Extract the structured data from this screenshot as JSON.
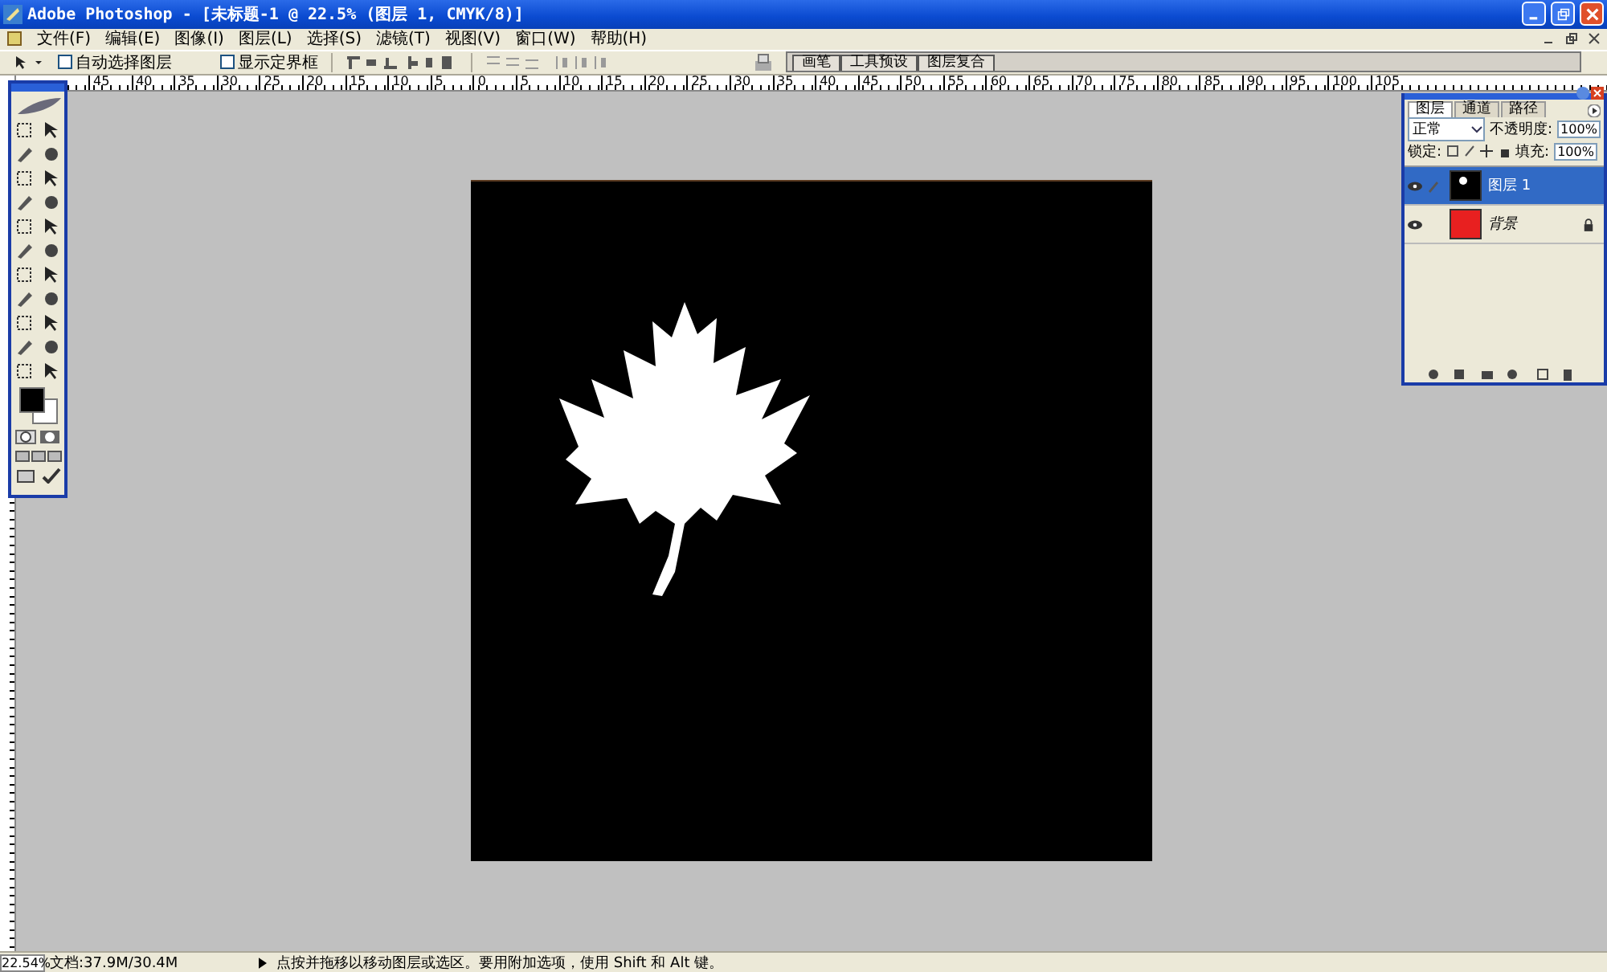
{
  "window": {
    "title": "Adobe Photoshop - [未标题-1 @ 22.5% (图层 1, CMYK/8)]"
  },
  "menu": [
    "文件(F)",
    "编辑(E)",
    "图像(I)",
    "图层(L)",
    "选择(S)",
    "滤镜(T)",
    "视图(V)",
    "窗口(W)",
    "帮助(H)"
  ],
  "options_bar": {
    "checkboxes": [
      {
        "label": "自动选择图层",
        "checked": false
      },
      {
        "label": "显示定界框",
        "checked": false
      }
    ]
  },
  "palette_well": {
    "tabs": [
      "画笔",
      "工具预设",
      "图层复合"
    ]
  },
  "ruler": {
    "labels": [
      "45",
      "40",
      "35",
      "30",
      "25",
      "20",
      "15",
      "10",
      "5",
      "0",
      "5",
      "10",
      "15",
      "20",
      "25",
      "30",
      "35",
      "40",
      "45",
      "50",
      "55",
      "60",
      "65",
      "70",
      "75",
      "80",
      "85",
      "90",
      "95",
      "100",
      "105"
    ]
  },
  "layers_panel": {
    "tabs": [
      {
        "label": "图层",
        "selected": true
      },
      {
        "label": "通道",
        "selected": false
      },
      {
        "label": "路径",
        "selected": false
      }
    ],
    "blend_mode": "正常",
    "opacity_label": "不透明度:",
    "opacity": "100%",
    "lock_label": "锁定:",
    "fill_label": "填充:",
    "fill": "100%",
    "layers": [
      {
        "name": "图层 1",
        "kind": "layer",
        "selected": true,
        "visible": true,
        "locked": false,
        "color": "#000000"
      },
      {
        "name": "背景",
        "kind": "background",
        "selected": false,
        "visible": true,
        "locked": true,
        "color": "#e82020"
      }
    ]
  },
  "status_bar": {
    "zoom": "22.54%",
    "document": "文档:37.9M/30.4M",
    "hint": "点按并拖移以移动图层或选区。要用附加选项，使用 Shift 和 Alt 键。"
  }
}
